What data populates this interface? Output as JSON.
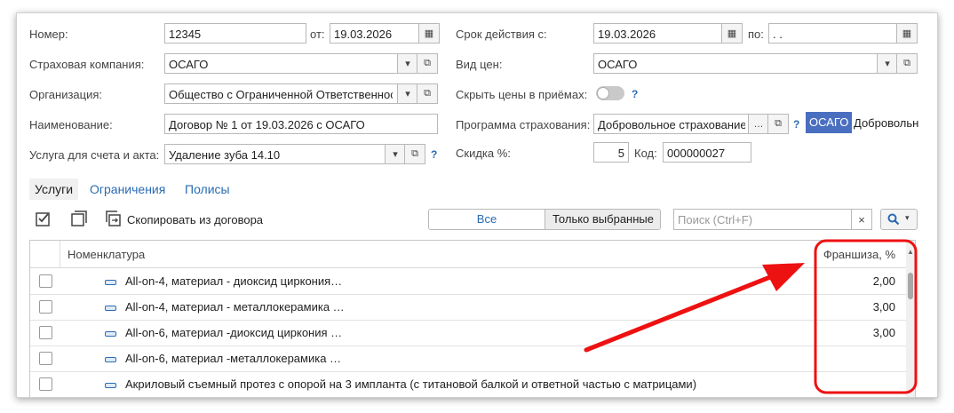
{
  "left": {
    "nomer_label": "Номер:",
    "nomer_value": "12345",
    "ot_label": "от:",
    "ot_value": "19.03.2026",
    "company_label": "Страховая компания:",
    "company_value": "ОСАГО",
    "org_label": "Организация:",
    "org_value": "Общество с Ограниченной Ответственность",
    "name_label": "Наименование:",
    "name_value": "Договор № 1 от 19.03.2026 с ОСАГО",
    "service_label": "Услуга для счета и акта:",
    "service_value": "Удаление зуба 14.10",
    "help": "?"
  },
  "right": {
    "validity_label": "Срок действия с:",
    "validity_from": "19.03.2026",
    "po_label": "по:",
    "validity_to": " .  .",
    "price_type_label": "Вид цен:",
    "price_type_value": "ОСАГО",
    "hide_prices_label": "Скрыть цены в приёмах:",
    "program_label": "Программа страхования:",
    "program_value": "Добровольное страхование",
    "program_tag": "ОСАГО",
    "program_tag_text": "Добровольн",
    "discount_label": "Скидка %:",
    "discount_value": "5",
    "code_label": "Код:",
    "code_value": "000000027",
    "help": "?"
  },
  "tabs": [
    "Услуги",
    "Ограничения",
    "Полисы"
  ],
  "toolbar": {
    "copy_label": "Скопировать из договора",
    "filter_all": "Все",
    "filter_selected": "Только выбранные",
    "search_placeholder": "Поиск (Ctrl+F)",
    "clear": "×"
  },
  "table": {
    "col_nomenclature": "Номенклатура",
    "col_franchise": "Франшиза, %",
    "rows": [
      {
        "name": "All-on-4, материал - диоксид циркония…",
        "value": "2,00"
      },
      {
        "name": "All-on-4, материал - металлокерамика …",
        "value": "3,00"
      },
      {
        "name": "All-on-6, материал -диоксид циркония …",
        "value": "3,00"
      },
      {
        "name": "All-on-6, материал -металлокерамика …",
        "value": ""
      },
      {
        "name": "Акриловый съемный протез с опорой на 3 импланта (с титановой балкой и ответной частью с матрицами)",
        "value": ""
      }
    ]
  },
  "colors": {
    "accent": "#2a6bb3",
    "annotation": "#ee1111",
    "tag_bg": "#4a6fc0"
  }
}
